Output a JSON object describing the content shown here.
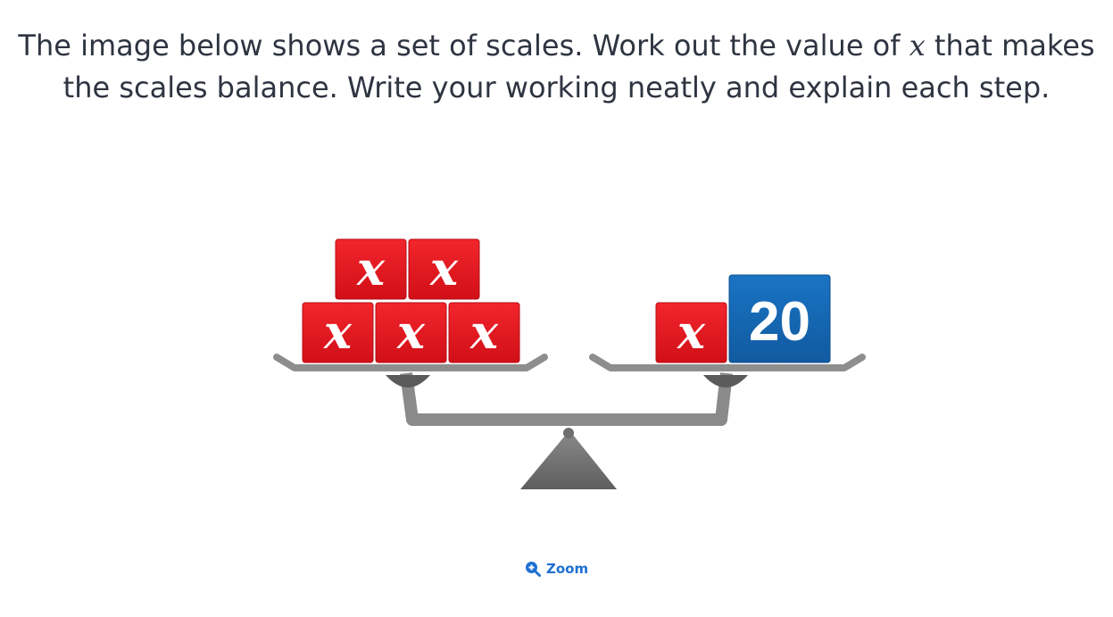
{
  "question": {
    "text_before": "The image below shows a set of scales. Work out the value of ",
    "variable": "x",
    "text_after": " that makes the scales balance. Write your working neatly and explain each step."
  },
  "scale": {
    "left_pan": {
      "blocks": [
        "x",
        "x",
        "x",
        "x",
        "x"
      ]
    },
    "right_pan": {
      "blocks": [
        "x"
      ],
      "number_block": "20"
    },
    "colors": {
      "x_block": "#e5141c",
      "number_block": "#1565b0",
      "frame": "#7d7d7d"
    }
  },
  "zoom": {
    "label": "Zoom",
    "icon": "zoom-in-icon"
  }
}
